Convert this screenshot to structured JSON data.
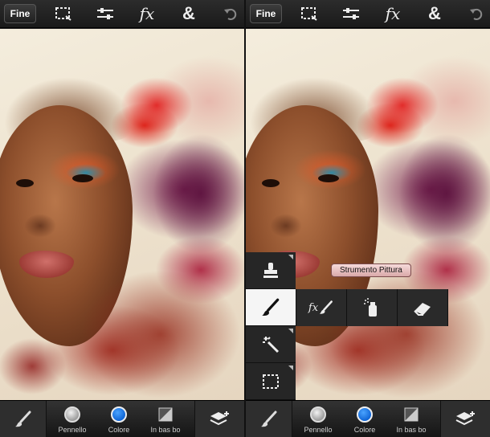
{
  "toolbar": {
    "done_label": "Fine",
    "icons": [
      "selection-icon",
      "adjustments-icon",
      "effects-icon",
      "blend-icon",
      "undo-icon"
    ],
    "fx_label": "fx",
    "amp_label": "&"
  },
  "bottom_bar": {
    "brush_icon": "brush-icon",
    "brush_label": "Pennello",
    "color_label": "Colore",
    "blend_label": "In bas bo",
    "layers_icon": "layers-add-icon",
    "brush_color": "#cfcfcf",
    "color_swatch": "#1a73e8"
  },
  "tool_menu": {
    "vertical_tools": [
      "stamp-icon",
      "brush-icon",
      "magic-wand-icon",
      "marquee-icon"
    ],
    "active_tool": "brush-icon",
    "horizontal_tools": [
      "fx-brush-icon",
      "spray-icon",
      "eraser-icon"
    ],
    "tooltip": "Strumento Pittura",
    "fx_brush_label": "fx"
  }
}
